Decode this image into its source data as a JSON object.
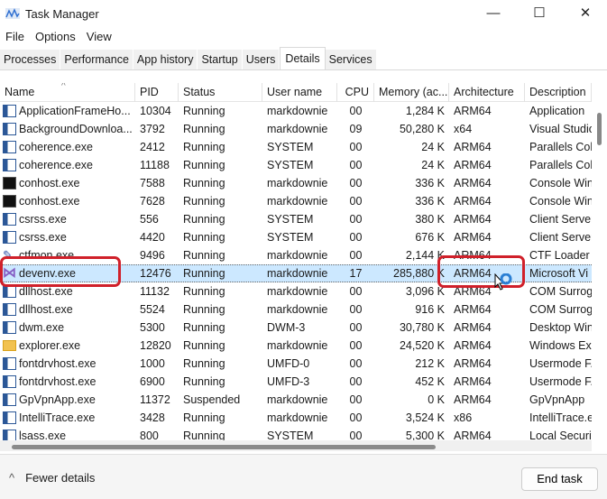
{
  "window": {
    "title": "Task Manager",
    "minimize": "—",
    "maximize": "☐",
    "close": "✕"
  },
  "menu": [
    "File",
    "Options",
    "View"
  ],
  "tabs": [
    {
      "label": "Processes"
    },
    {
      "label": "Performance"
    },
    {
      "label": "App history"
    },
    {
      "label": "Startup"
    },
    {
      "label": "Users"
    },
    {
      "label": "Details",
      "active": true
    },
    {
      "label": "Services"
    }
  ],
  "columns": [
    "Name",
    "PID",
    "Status",
    "User name",
    "CPU",
    "Memory (ac...",
    "Architecture",
    "Description"
  ],
  "sort_indicator": "^",
  "rows": [
    {
      "icon": "app",
      "name": "ApplicationFrameHo...",
      "pid": "10304",
      "status": "Running",
      "user": "markdownie",
      "cpu": "00",
      "mem": "1,284 K",
      "arch": "ARM64",
      "desc": "Application"
    },
    {
      "icon": "app",
      "name": "BackgroundDownloa...",
      "pid": "3792",
      "status": "Running",
      "user": "markdownie",
      "cpu": "09",
      "mem": "50,280 K",
      "arch": "x64",
      "desc": "Visual Studio"
    },
    {
      "icon": "app",
      "name": "coherence.exe",
      "pid": "2412",
      "status": "Running",
      "user": "SYSTEM",
      "cpu": "00",
      "mem": "24 K",
      "arch": "ARM64",
      "desc": "Parallels Coh"
    },
    {
      "icon": "app",
      "name": "coherence.exe",
      "pid": "11188",
      "status": "Running",
      "user": "SYSTEM",
      "cpu": "00",
      "mem": "24 K",
      "arch": "ARM64",
      "desc": "Parallels Coh"
    },
    {
      "icon": "console",
      "name": "conhost.exe",
      "pid": "7588",
      "status": "Running",
      "user": "markdownie",
      "cpu": "00",
      "mem": "336 K",
      "arch": "ARM64",
      "desc": "Console Win"
    },
    {
      "icon": "console",
      "name": "conhost.exe",
      "pid": "7628",
      "status": "Running",
      "user": "markdownie",
      "cpu": "00",
      "mem": "336 K",
      "arch": "ARM64",
      "desc": "Console Win"
    },
    {
      "icon": "app",
      "name": "csrss.exe",
      "pid": "556",
      "status": "Running",
      "user": "SYSTEM",
      "cpu": "00",
      "mem": "380 K",
      "arch": "ARM64",
      "desc": "Client Server"
    },
    {
      "icon": "app",
      "name": "csrss.exe",
      "pid": "4420",
      "status": "Running",
      "user": "SYSTEM",
      "cpu": "00",
      "mem": "676 K",
      "arch": "ARM64",
      "desc": "Client Server"
    },
    {
      "icon": "pen",
      "name": "ctfmon.exe",
      "pid": "9496",
      "status": "Running",
      "user": "markdownie",
      "cpu": "00",
      "mem": "2,144 K",
      "arch": "ARM64",
      "desc": "CTF Loader"
    },
    {
      "icon": "vs",
      "name": "devenv.exe",
      "pid": "12476",
      "status": "Running",
      "user": "markdownie",
      "cpu": "17",
      "mem": "285,880 K",
      "arch": "ARM64",
      "desc": "Microsoft Vi",
      "selected": true
    },
    {
      "icon": "app",
      "name": "dllhost.exe",
      "pid": "11132",
      "status": "Running",
      "user": "markdownie",
      "cpu": "00",
      "mem": "3,096 K",
      "arch": "ARM64",
      "desc": "COM Surrog"
    },
    {
      "icon": "app",
      "name": "dllhost.exe",
      "pid": "5524",
      "status": "Running",
      "user": "markdownie",
      "cpu": "00",
      "mem": "916 K",
      "arch": "ARM64",
      "desc": "COM Surrog"
    },
    {
      "icon": "app",
      "name": "dwm.exe",
      "pid": "5300",
      "status": "Running",
      "user": "DWM-3",
      "cpu": "00",
      "mem": "30,780 K",
      "arch": "ARM64",
      "desc": "Desktop Win"
    },
    {
      "icon": "folder",
      "name": "explorer.exe",
      "pid": "12820",
      "status": "Running",
      "user": "markdownie",
      "cpu": "00",
      "mem": "24,520 K",
      "arch": "ARM64",
      "desc": "Windows Ex"
    },
    {
      "icon": "app",
      "name": "fontdrvhost.exe",
      "pid": "1000",
      "status": "Running",
      "user": "UMFD-0",
      "cpu": "00",
      "mem": "212 K",
      "arch": "ARM64",
      "desc": "Usermode F."
    },
    {
      "icon": "app",
      "name": "fontdrvhost.exe",
      "pid": "6900",
      "status": "Running",
      "user": "UMFD-3",
      "cpu": "00",
      "mem": "452 K",
      "arch": "ARM64",
      "desc": "Usermode F."
    },
    {
      "icon": "app",
      "name": "GpVpnApp.exe",
      "pid": "11372",
      "status": "Suspended",
      "user": "markdownie",
      "cpu": "00",
      "mem": "0 K",
      "arch": "ARM64",
      "desc": "GpVpnApp"
    },
    {
      "icon": "app",
      "name": "IntelliTrace.exe",
      "pid": "3428",
      "status": "Running",
      "user": "markdownie",
      "cpu": "00",
      "mem": "3,524 K",
      "arch": "x86",
      "desc": "IntelliTrace.e"
    },
    {
      "icon": "app",
      "name": "lsass.exe",
      "pid": "800",
      "status": "Running",
      "user": "SYSTEM",
      "cpu": "00",
      "mem": "5,300 K",
      "arch": "ARM64",
      "desc": "Local Securit"
    }
  ],
  "footer": {
    "fewer_details": "Fewer details",
    "end_task": "End task",
    "chevron": "^"
  },
  "colors": {
    "selection": "#cce8ff",
    "highlight": "#d0202a"
  }
}
